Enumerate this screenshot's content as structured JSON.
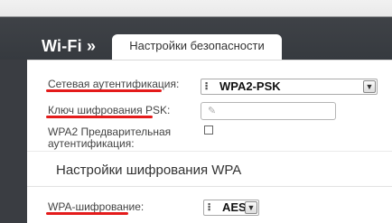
{
  "header": {
    "section_title": "Wi-Fi »",
    "tab_label": "Настройки безопасности"
  },
  "form": {
    "network_auth": {
      "label": "Сетевая аутентификация:",
      "value": "WPA2-PSK"
    },
    "psk_key": {
      "label": "Ключ шифрования PSK:",
      "value": ""
    },
    "wpa2_preauth": {
      "label_line1": "WPA2 Предварительная",
      "label_line2": "аутентификация:",
      "checked": false
    },
    "wpa_section_title": "Настройки шифрования WPA",
    "wpa_encryption": {
      "label": "WPA-шифрование:",
      "value": "AES"
    }
  },
  "colors": {
    "annotation_underline": "#e41b1b",
    "header_bg": "#3a3d42"
  },
  "icons": {
    "select_list": "list-icon",
    "dropdown": "chevron-down-icon",
    "edit": "pencil-icon"
  }
}
